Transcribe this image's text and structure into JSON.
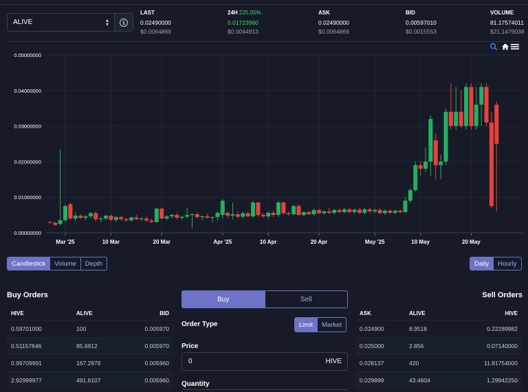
{
  "market": {
    "selected": "ALIVE"
  },
  "stats": {
    "last": {
      "label": "LAST",
      "value": "0.02490000",
      "usd": "$0.0064869"
    },
    "h24": {
      "label": "24H",
      "pct": "225.05%",
      "value": "0.01723960",
      "usd": "$0.0044913"
    },
    "ask": {
      "label": "ASK",
      "value": "0.02490000",
      "usd": "$0.0064869"
    },
    "bid": {
      "label": "BID",
      "value": "0.00597010",
      "usd": "$0.0015553"
    },
    "volume": {
      "label": "VOLUME",
      "value": "81.17574011",
      "usd": "$21.1479038"
    }
  },
  "colors": {
    "up": "#27ae60",
    "down": "#e8413e",
    "accent": "#6e73c6",
    "green_text": "#4cd964"
  },
  "chart_data": {
    "type": "candlestick",
    "title": "",
    "y_ticks": [
      "0.05000000",
      "0.04000000",
      "0.03000000",
      "0.02000000",
      "0.01000000",
      "0.00000000"
    ],
    "ylim": [
      0,
      0.05
    ],
    "x_ticks": [
      "Mar '25",
      "10 Mar",
      "20 Mar",
      "Apr '25",
      "10 Apr",
      "20 Apr",
      "May '25",
      "10 May",
      "20 May"
    ],
    "x_tick_days": [
      0,
      9,
      19,
      31,
      40,
      50,
      61,
      70,
      80
    ],
    "grid": true,
    "candles": [
      {
        "d": -3,
        "o": 0.003,
        "h": 0.0032,
        "l": 0.0026,
        "c": 0.0028
      },
      {
        "d": -2,
        "o": 0.0028,
        "h": 0.003,
        "l": 0.002,
        "c": 0.0022
      },
      {
        "d": -1,
        "o": 0.0025,
        "h": 0.0235,
        "l": 0.002,
        "c": 0.0035
      },
      {
        "d": 0,
        "o": 0.0035,
        "h": 0.008,
        "l": 0.003,
        "c": 0.0075
      },
      {
        "d": 1,
        "o": 0.008,
        "h": 0.0085,
        "l": 0.0035,
        "c": 0.004
      },
      {
        "d": 2,
        "o": 0.004,
        "h": 0.0058,
        "l": 0.0033,
        "c": 0.0048
      },
      {
        "d": 3,
        "o": 0.0048,
        "h": 0.0052,
        "l": 0.0038,
        "c": 0.0042
      },
      {
        "d": 4,
        "o": 0.0042,
        "h": 0.005,
        "l": 0.0036,
        "c": 0.0046
      },
      {
        "d": 5,
        "o": 0.0046,
        "h": 0.0058,
        "l": 0.004,
        "c": 0.0055
      },
      {
        "d": 6,
        "o": 0.0055,
        "h": 0.006,
        "l": 0.0032,
        "c": 0.0038
      },
      {
        "d": 7,
        "o": 0.0038,
        "h": 0.0045,
        "l": 0.003,
        "c": 0.004
      },
      {
        "d": 8,
        "o": 0.004,
        "h": 0.005,
        "l": 0.0035,
        "c": 0.0048
      },
      {
        "d": 9,
        "o": 0.0048,
        "h": 0.0052,
        "l": 0.0033,
        "c": 0.0036
      },
      {
        "d": 10,
        "o": 0.0036,
        "h": 0.0046,
        "l": 0.003,
        "c": 0.0044
      },
      {
        "d": 11,
        "o": 0.0044,
        "h": 0.0048,
        "l": 0.0034,
        "c": 0.0038
      },
      {
        "d": 12,
        "o": 0.0038,
        "h": 0.0042,
        "l": 0.003,
        "c": 0.0035
      },
      {
        "d": 13,
        "o": 0.0035,
        "h": 0.0045,
        "l": 0.003,
        "c": 0.0043
      },
      {
        "d": 14,
        "o": 0.0043,
        "h": 0.005,
        "l": 0.0035,
        "c": 0.0038
      },
      {
        "d": 15,
        "o": 0.0038,
        "h": 0.0044,
        "l": 0.0032,
        "c": 0.004
      },
      {
        "d": 16,
        "o": 0.004,
        "h": 0.0046,
        "l": 0.003,
        "c": 0.0034
      },
      {
        "d": 17,
        "o": 0.0034,
        "h": 0.004,
        "l": 0.0028,
        "c": 0.003
      },
      {
        "d": 18,
        "o": 0.003,
        "h": 0.007,
        "l": 0.0028,
        "c": 0.0068
      },
      {
        "d": 19,
        "o": 0.0068,
        "h": 0.007,
        "l": 0.0038,
        "c": 0.004
      },
      {
        "d": 20,
        "o": 0.004,
        "h": 0.005,
        "l": 0.0035,
        "c": 0.0046
      },
      {
        "d": 21,
        "o": 0.0046,
        "h": 0.0052,
        "l": 0.004,
        "c": 0.005
      },
      {
        "d": 22,
        "o": 0.005,
        "h": 0.0055,
        "l": 0.0038,
        "c": 0.0042
      },
      {
        "d": 23,
        "o": 0.0042,
        "h": 0.0047,
        "l": 0.0035,
        "c": 0.0045
      },
      {
        "d": 24,
        "o": 0.0045,
        "h": 0.007,
        "l": 0.004,
        "c": 0.005
      },
      {
        "d": 25,
        "o": 0.005,
        "h": 0.0055,
        "l": 0.0012,
        "c": 0.0052
      },
      {
        "d": 26,
        "o": 0.0052,
        "h": 0.0058,
        "l": 0.004,
        "c": 0.0044
      },
      {
        "d": 27,
        "o": 0.0044,
        "h": 0.0048,
        "l": 0.0035,
        "c": 0.0046
      },
      {
        "d": 28,
        "o": 0.0046,
        "h": 0.0055,
        "l": 0.004,
        "c": 0.0042
      },
      {
        "d": 29,
        "o": 0.0042,
        "h": 0.0046,
        "l": 0.003,
        "c": 0.0044
      },
      {
        "d": 30,
        "o": 0.0044,
        "h": 0.006,
        "l": 0.0035,
        "c": 0.0056
      },
      {
        "d": 31,
        "o": 0.005,
        "h": 0.0095,
        "l": 0.004,
        "c": 0.009
      },
      {
        "d": 32,
        "o": 0.0056,
        "h": 0.006,
        "l": 0.0042,
        "c": 0.0048
      },
      {
        "d": 33,
        "o": 0.0048,
        "h": 0.0085,
        "l": 0.0038,
        "c": 0.0052
      },
      {
        "d": 34,
        "o": 0.0052,
        "h": 0.006,
        "l": 0.004,
        "c": 0.0045
      },
      {
        "d": 35,
        "o": 0.0045,
        "h": 0.006,
        "l": 0.004,
        "c": 0.0055
      },
      {
        "d": 36,
        "o": 0.0055,
        "h": 0.006,
        "l": 0.0042,
        "c": 0.0046
      },
      {
        "d": 37,
        "o": 0.0046,
        "h": 0.009,
        "l": 0.0042,
        "c": 0.0085
      },
      {
        "d": 38,
        "o": 0.0085,
        "h": 0.0088,
        "l": 0.0045,
        "c": 0.005
      },
      {
        "d": 39,
        "o": 0.005,
        "h": 0.0055,
        "l": 0.0042,
        "c": 0.0046
      },
      {
        "d": 40,
        "o": 0.0046,
        "h": 0.006,
        "l": 0.004,
        "c": 0.0056
      },
      {
        "d": 41,
        "o": 0.0056,
        "h": 0.0062,
        "l": 0.0044,
        "c": 0.005
      },
      {
        "d": 42,
        "o": 0.005,
        "h": 0.009,
        "l": 0.0045,
        "c": 0.0085
      },
      {
        "d": 43,
        "o": 0.0085,
        "h": 0.0088,
        "l": 0.005,
        "c": 0.0055
      },
      {
        "d": 44,
        "o": 0.0055,
        "h": 0.006,
        "l": 0.0048,
        "c": 0.0052
      },
      {
        "d": 45,
        "o": 0.0052,
        "h": 0.008,
        "l": 0.0048,
        "c": 0.0075
      },
      {
        "d": 46,
        "o": 0.0075,
        "h": 0.008,
        "l": 0.0048,
        "c": 0.005
      },
      {
        "d": 47,
        "o": 0.005,
        "h": 0.006,
        "l": 0.0046,
        "c": 0.0058
      },
      {
        "d": 48,
        "o": 0.0058,
        "h": 0.0062,
        "l": 0.005,
        "c": 0.0052
      },
      {
        "d": 49,
        "o": 0.0052,
        "h": 0.0068,
        "l": 0.0048,
        "c": 0.0064
      },
      {
        "d": 50,
        "o": 0.0064,
        "h": 0.0068,
        "l": 0.0052,
        "c": 0.0055
      },
      {
        "d": 51,
        "o": 0.0055,
        "h": 0.0062,
        "l": 0.005,
        "c": 0.006
      },
      {
        "d": 52,
        "o": 0.006,
        "h": 0.007,
        "l": 0.0052,
        "c": 0.0056
      },
      {
        "d": 53,
        "o": 0.0056,
        "h": 0.0066,
        "l": 0.005,
        "c": 0.0064
      },
      {
        "d": 54,
        "o": 0.0064,
        "h": 0.0068,
        "l": 0.0055,
        "c": 0.0058
      },
      {
        "d": 55,
        "o": 0.0058,
        "h": 0.007,
        "l": 0.0054,
        "c": 0.0066
      },
      {
        "d": 56,
        "o": 0.0066,
        "h": 0.007,
        "l": 0.0055,
        "c": 0.0058
      },
      {
        "d": 57,
        "o": 0.0058,
        "h": 0.0068,
        "l": 0.0054,
        "c": 0.0065
      },
      {
        "d": 58,
        "o": 0.0065,
        "h": 0.007,
        "l": 0.0052,
        "c": 0.0056
      },
      {
        "d": 59,
        "o": 0.0056,
        "h": 0.007,
        "l": 0.0052,
        "c": 0.0066
      },
      {
        "d": 60,
        "o": 0.0066,
        "h": 0.007,
        "l": 0.0055,
        "c": 0.006
      },
      {
        "d": 61,
        "o": 0.006,
        "h": 0.0068,
        "l": 0.0054,
        "c": 0.0064
      },
      {
        "d": 62,
        "o": 0.0064,
        "h": 0.0068,
        "l": 0.0052,
        "c": 0.0055
      },
      {
        "d": 63,
        "o": 0.0055,
        "h": 0.0066,
        "l": 0.005,
        "c": 0.0062
      },
      {
        "d": 64,
        "o": 0.0062,
        "h": 0.0066,
        "l": 0.0052,
        "c": 0.0056
      },
      {
        "d": 65,
        "o": 0.0056,
        "h": 0.0065,
        "l": 0.0052,
        "c": 0.0062
      },
      {
        "d": 66,
        "o": 0.0062,
        "h": 0.0065,
        "l": 0.0054,
        "c": 0.0058
      },
      {
        "d": 67,
        "o": 0.0058,
        "h": 0.01,
        "l": 0.0055,
        "c": 0.009
      },
      {
        "d": 68,
        "o": 0.009,
        "h": 0.0125,
        "l": 0.0085,
        "c": 0.012
      },
      {
        "d": 69,
        "o": 0.012,
        "h": 0.02,
        "l": 0.0115,
        "c": 0.019
      },
      {
        "d": 70,
        "o": 0.019,
        "h": 0.02,
        "l": 0.016,
        "c": 0.018
      },
      {
        "d": 71,
        "o": 0.018,
        "h": 0.024,
        "l": 0.017,
        "c": 0.02
      },
      {
        "d": 72,
        "o": 0.02,
        "h": 0.033,
        "l": 0.016,
        "c": 0.032
      },
      {
        "d": 73,
        "o": 0.026,
        "h": 0.028,
        "l": 0.015,
        "c": 0.019
      },
      {
        "d": 74,
        "o": 0.019,
        "h": 0.022,
        "l": 0.015,
        "c": 0.02
      },
      {
        "d": 75,
        "o": 0.02,
        "h": 0.035,
        "l": 0.019,
        "c": 0.034
      },
      {
        "d": 76,
        "o": 0.034,
        "h": 0.042,
        "l": 0.029,
        "c": 0.03
      },
      {
        "d": 77,
        "o": 0.03,
        "h": 0.041,
        "l": 0.029,
        "c": 0.034
      },
      {
        "d": 78,
        "o": 0.034,
        "h": 0.04,
        "l": 0.0295,
        "c": 0.03
      },
      {
        "d": 79,
        "o": 0.03,
        "h": 0.042,
        "l": 0.029,
        "c": 0.041
      },
      {
        "d": 80,
        "o": 0.041,
        "h": 0.042,
        "l": 0.029,
        "c": 0.03
      },
      {
        "d": 81,
        "o": 0.03,
        "h": 0.041,
        "l": 0.029,
        "c": 0.036
      },
      {
        "d": 82,
        "o": 0.036,
        "h": 0.042,
        "l": 0.03,
        "c": 0.041
      },
      {
        "d": 83,
        "o": 0.041,
        "h": 0.042,
        "l": 0.03,
        "c": 0.031
      },
      {
        "d": 84,
        "o": 0.031,
        "h": 0.034,
        "l": 0.007,
        "c": 0.0075
      },
      {
        "d": 85,
        "o": 0.036,
        "h": 0.037,
        "l": 0.006,
        "c": 0.025
      }
    ]
  },
  "chart_tabs": {
    "candlestick": "Candlestick",
    "volume": "Volume",
    "depth": "Depth"
  },
  "interval_tabs": {
    "daily": "Daily",
    "hourly": "Hourly"
  },
  "buy_orders": {
    "title": "Buy Orders",
    "columns": [
      "HIVE",
      "ALIVE",
      "BID"
    ],
    "rows": [
      [
        "0.59701000",
        "100",
        "0.005970"
      ],
      [
        "0.51157646",
        "85.6912",
        "0.005970"
      ],
      [
        "0.99709991",
        "167.2978",
        "0.005960"
      ],
      [
        "2.92999977",
        "491.6107",
        "0.005960"
      ]
    ]
  },
  "sell_orders": {
    "title": "Sell Orders",
    "columns": [
      "ASK",
      "ALIVE",
      "HIVE"
    ],
    "rows": [
      [
        "0.024900",
        "8.9518",
        "0.22289982"
      ],
      [
        "0.025000",
        "2.856",
        "0.07140000"
      ],
      [
        "0.028137",
        "420",
        "11.81754000"
      ],
      [
        "0.029899",
        "43.4604",
        "1.29942250"
      ]
    ]
  },
  "trade_form": {
    "buy_label": "Buy",
    "sell_label": "Sell",
    "order_type_label": "Order Type",
    "limit_label": "Limit",
    "market_label": "Market",
    "price_label": "Price",
    "price_value": "0",
    "price_unit": "HIVE",
    "quantity_label": "Quantity"
  }
}
